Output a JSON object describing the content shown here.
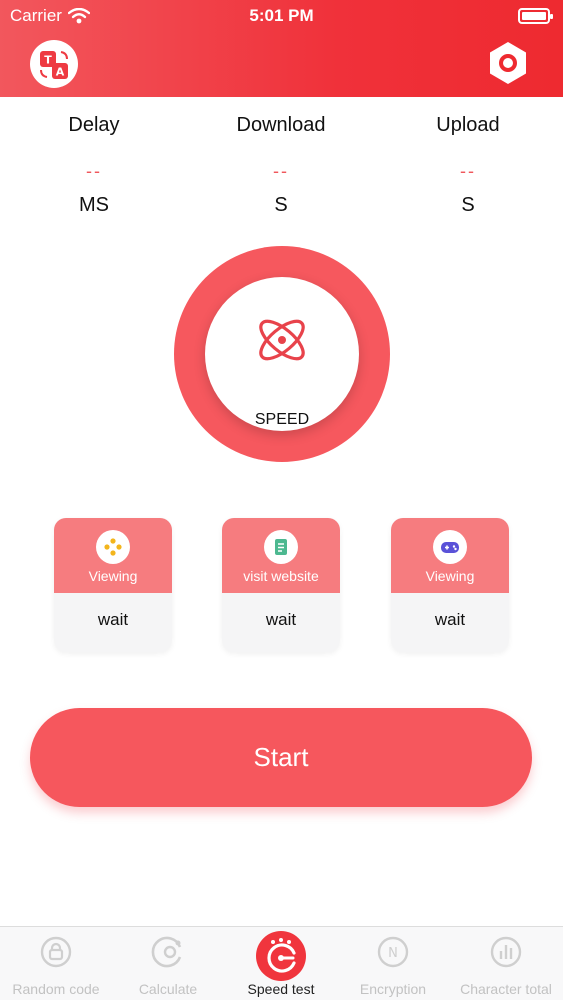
{
  "status_bar": {
    "carrier": "Carrier",
    "time": "5:01 PM"
  },
  "stats": [
    {
      "label": "Delay",
      "value": "--",
      "unit": "MS"
    },
    {
      "label": "Download",
      "value": "--",
      "unit": "S"
    },
    {
      "label": "Upload",
      "value": "--",
      "unit": "S"
    }
  ],
  "gauge": {
    "label": "SPEED"
  },
  "cards": [
    {
      "title": "Viewing",
      "status": "wait",
      "icon": "viewing-icon"
    },
    {
      "title": "visit website",
      "status": "wait",
      "icon": "website-icon"
    },
    {
      "title": "Viewing",
      "status": "wait",
      "icon": "gamepad-icon"
    }
  ],
  "start_button": {
    "label": "Start"
  },
  "tabs": [
    {
      "label": "Random code",
      "icon": "random-code-icon"
    },
    {
      "label": "Calculate",
      "icon": "calculate-icon"
    },
    {
      "label": "Speed test",
      "icon": "speed-test-icon",
      "active": true
    },
    {
      "label": "Encryption",
      "icon": "encryption-icon"
    },
    {
      "label": "Character total",
      "icon": "character-total-icon"
    }
  ],
  "colors": {
    "accent": "#f0353d",
    "ring": "#f6585e",
    "card_top": "#f67c7f",
    "value_dash": "#f0575c"
  }
}
